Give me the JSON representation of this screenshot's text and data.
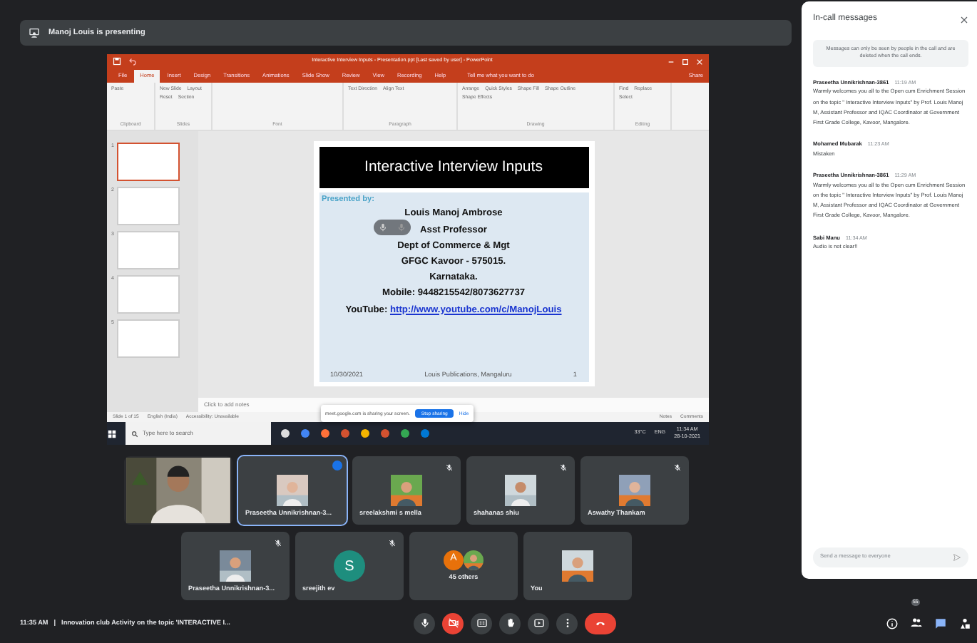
{
  "presenter_bar": {
    "text": "Manoj Louis is presenting"
  },
  "shared_screen": {
    "title": "Interactive Interview Inputs - Presentation.ppt [Last saved by user] - PowerPoint",
    "tabs": [
      {
        "label": "File",
        "selected": false
      },
      {
        "label": "Home",
        "selected": true
      },
      {
        "label": "Insert",
        "selected": false
      },
      {
        "label": "Design",
        "selected": false
      },
      {
        "label": "Transitions",
        "selected": false
      },
      {
        "label": "Animations",
        "selected": false
      },
      {
        "label": "Slide Show",
        "selected": false
      },
      {
        "label": "Review",
        "selected": false
      },
      {
        "label": "View",
        "selected": false
      },
      {
        "label": "Recording",
        "selected": false
      },
      {
        "label": "Help",
        "selected": false
      }
    ],
    "tell_me": "Tell me what you want to do",
    "share": "Share",
    "ribbon_groups": [
      {
        "name": "Clipboard",
        "buttons": [
          "Paste"
        ]
      },
      {
        "name": "Slides",
        "buttons": [
          "New Slide",
          "Layout",
          "Reset",
          "Section"
        ]
      },
      {
        "name": "Font"
      },
      {
        "name": "Paragraph",
        "buttons": [
          "Text Direction",
          "Align Text"
        ]
      },
      {
        "name": "Drawing",
        "buttons": [
          "Arrange",
          "Quick Styles",
          "Shape Fill",
          "Shape Outline",
          "Shape Effects"
        ]
      },
      {
        "name": "Editing",
        "buttons": [
          "Find",
          "Replace",
          "Select"
        ]
      }
    ],
    "thumbnails": [
      {
        "number": "1",
        "selected": true
      },
      {
        "number": "2",
        "selected": false
      },
      {
        "number": "3",
        "selected": false
      },
      {
        "number": "4",
        "selected": false
      },
      {
        "number": "5",
        "selected": false
      }
    ],
    "slide": {
      "title": "Interactive Interview Inputs",
      "presented_by": "Presented by:",
      "lines": [
        "Louis Manoj Ambrose",
        "Asst Professor",
        "Dept of Commerce & Mgt",
        "GFGC Kavoor - 575015.",
        "Karnataka.",
        "Mobile: 9448215542/8073627737"
      ],
      "link_label": "YouTube:",
      "link": "http://www.youtube.com/c/ManojLouis",
      "footer_date": "10/30/2021",
      "footer_text": "Louis Publications, Mangaluru",
      "footer_number": "1"
    },
    "notes_placeholder": "Click to add notes",
    "status_bar": [
      "Slide 1 of 15",
      "English (India)",
      "Accessibility: Unavailable"
    ],
    "status_right": [
      "Notes",
      "Comments"
    ],
    "sharing_notice": {
      "text": "meet.google.com is sharing your screen.",
      "stop": "Stop sharing",
      "hide": "Hide"
    },
    "taskbar": {
      "search_placeholder": "Type here to search",
      "weather": "33°C",
      "language": "ENG",
      "time": "11:34 AM",
      "date": "28-10-2021"
    }
  },
  "participants": [
    {
      "kind": "video",
      "selected": false,
      "muted": false,
      "speaking": false
    },
    {
      "name": "Praseetha Unnikrishnan-3...",
      "selected": true,
      "muted": false,
      "speaking": true
    },
    {
      "name": "sreelakshmi s mella",
      "selected": false,
      "muted": true,
      "speaking": false
    },
    {
      "name": "shahanas shiu",
      "selected": false,
      "muted": true,
      "speaking": false
    },
    {
      "name": "Aswathy Thankam",
      "selected": false,
      "muted": true,
      "speaking": false
    },
    {
      "name": "Praseetha Unnikrishnan-3...",
      "selected": false,
      "muted": true,
      "speaking": false
    },
    {
      "kind": "initial",
      "name": "sreejith ev",
      "initial": "S",
      "color": "#1e8e7e",
      "selected": false,
      "muted": true,
      "speaking": false
    },
    {
      "kind": "group",
      "name": "45 others",
      "initial": "A",
      "color": "#e8710a",
      "selected": false,
      "muted": false,
      "speaking": false
    },
    {
      "name": "You",
      "selected": false,
      "muted": false,
      "speaking": false
    }
  ],
  "bottom_bar": {
    "time": "11:35 AM",
    "separator": "|",
    "meeting_title": "Innovation club Activity on the topic 'INTERACTIVE I...",
    "controls": [
      {
        "kind": "mic",
        "on": true
      },
      {
        "kind": "camera",
        "on": false
      },
      {
        "kind": "captions"
      },
      {
        "kind": "hand"
      },
      {
        "kind": "present"
      },
      {
        "kind": "more"
      },
      {
        "kind": "hangup"
      }
    ],
    "side_buttons": [
      {
        "kind": "info",
        "selected": false
      },
      {
        "kind": "people",
        "selected": false,
        "count": "55"
      },
      {
        "kind": "chat",
        "selected": true
      },
      {
        "kind": "activities",
        "selected": false
      }
    ]
  },
  "chat": {
    "title": "In-call messages",
    "notice": "Messages can only be seen by people in the call and are deleted when the call ends.",
    "messages": [
      {
        "sender": "Praseetha Unnikrishnan-3861",
        "time": "11:19 AM",
        "text": "Warmly welcomes you all to the Open cum Enrichment Session on the topic \" Interactive Interview Inputs\" by Prof. Louis Manoj M, Assistant Professor and IQAC Coordinator at Government First Grade College, Kavoor, Mangalore."
      },
      {
        "sender": "Mohamed Mubarak",
        "time": "11:23 AM",
        "text": "Mistaken"
      },
      {
        "sender": "Praseetha Unnikrishnan-3861",
        "time": "11:29 AM",
        "text": "Warmly welcomes you all to the Open cum Enrichment Session on the topic \" Interactive Interview Inputs\" by Prof. Louis Manoj M, Assistant Professor and IQAC Coordinator at Government First Grade College, Kavoor, Mangalore."
      },
      {
        "sender": "Sabi Manu",
        "time": "11:34 AM",
        "text": "Audio is not clear!!"
      }
    ],
    "composer_placeholder": "Send a message to everyone"
  }
}
